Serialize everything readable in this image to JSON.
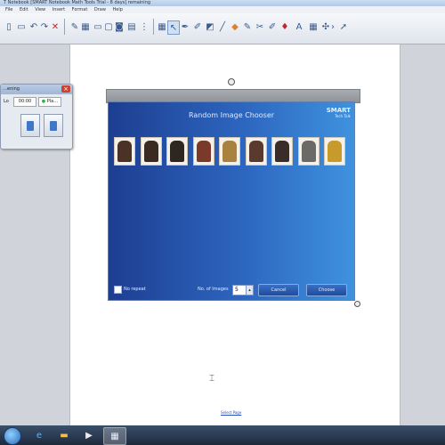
{
  "window": {
    "title": "T Notebook [SMART Notebook Math Tools Trial - 8 days] remaining"
  },
  "menu": [
    "File",
    "Edit",
    "View",
    "Insert",
    "Format",
    "Draw",
    "Help"
  ],
  "toolbar": {
    "icons": [
      "page-icon",
      "open-icon",
      "save-icon",
      "paste-icon",
      "undo-icon",
      "redo-icon",
      "delete-icon",
      "screen-shade-icon",
      "display-icon",
      "capture-icon",
      "document-camera-icon",
      "table-icon",
      "select-icon",
      "pen-icon",
      "creative-pen-icon",
      "eraser-icon",
      "line-icon",
      "shapes-icon",
      "fill-icon",
      "text-icon",
      "properties-icon",
      "move-toolbar-icon",
      "more-icon"
    ]
  },
  "floating_widget": {
    "title": "…ening",
    "row_label": "Lo",
    "value": "00:00",
    "status": "Pla…"
  },
  "gadget": {
    "title": "Random Image Chooser",
    "logo": "SMART",
    "logo_sub": "Tech Talk",
    "image_count": 9,
    "no_repeat_label": "No repeat",
    "num_images_label": "No. of Images",
    "num_images_value": "5",
    "cancel_label": "Cancel",
    "choose_label": "Choose"
  },
  "page_link": "Select Page",
  "taskbar": {
    "apps": [
      "ie-icon",
      "folder-icon",
      "media-icon",
      "notebook-icon"
    ]
  },
  "colors": {
    "gadget_left": "#1d3e91",
    "gadget_right": "#3f92de"
  }
}
